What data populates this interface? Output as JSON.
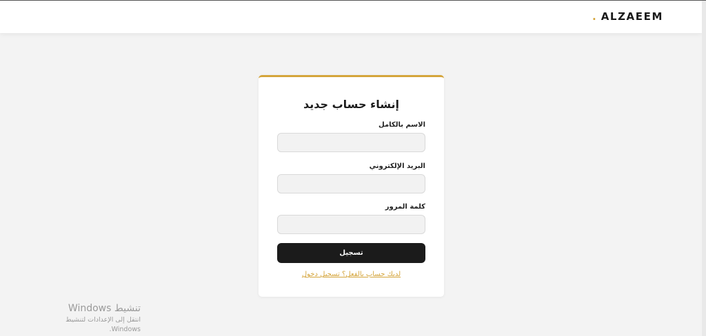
{
  "header": {
    "brand_dot": ".",
    "brand_name": "ALZAEEM"
  },
  "form": {
    "title": "إنشاء حساب جديد",
    "fields": [
      {
        "label": "الاسم بالكامل",
        "value": "",
        "placeholder": ""
      },
      {
        "label": "البريد الإلكتروني",
        "value": "",
        "placeholder": ""
      },
      {
        "label": "كلمة المرور",
        "value": "",
        "placeholder": ""
      }
    ],
    "submit_label": "تسجيل",
    "login_link": "لديك حساب بالفعل؟ تسجيل دخول"
  },
  "watermark": {
    "title": "تنشيط Windows",
    "subtitle": "انتقل إلى الإعدادات لتنشيط Windows."
  },
  "colors": {
    "accent": "#d4a43a",
    "button": "#1b1b1b",
    "background": "#f3f3f3"
  }
}
